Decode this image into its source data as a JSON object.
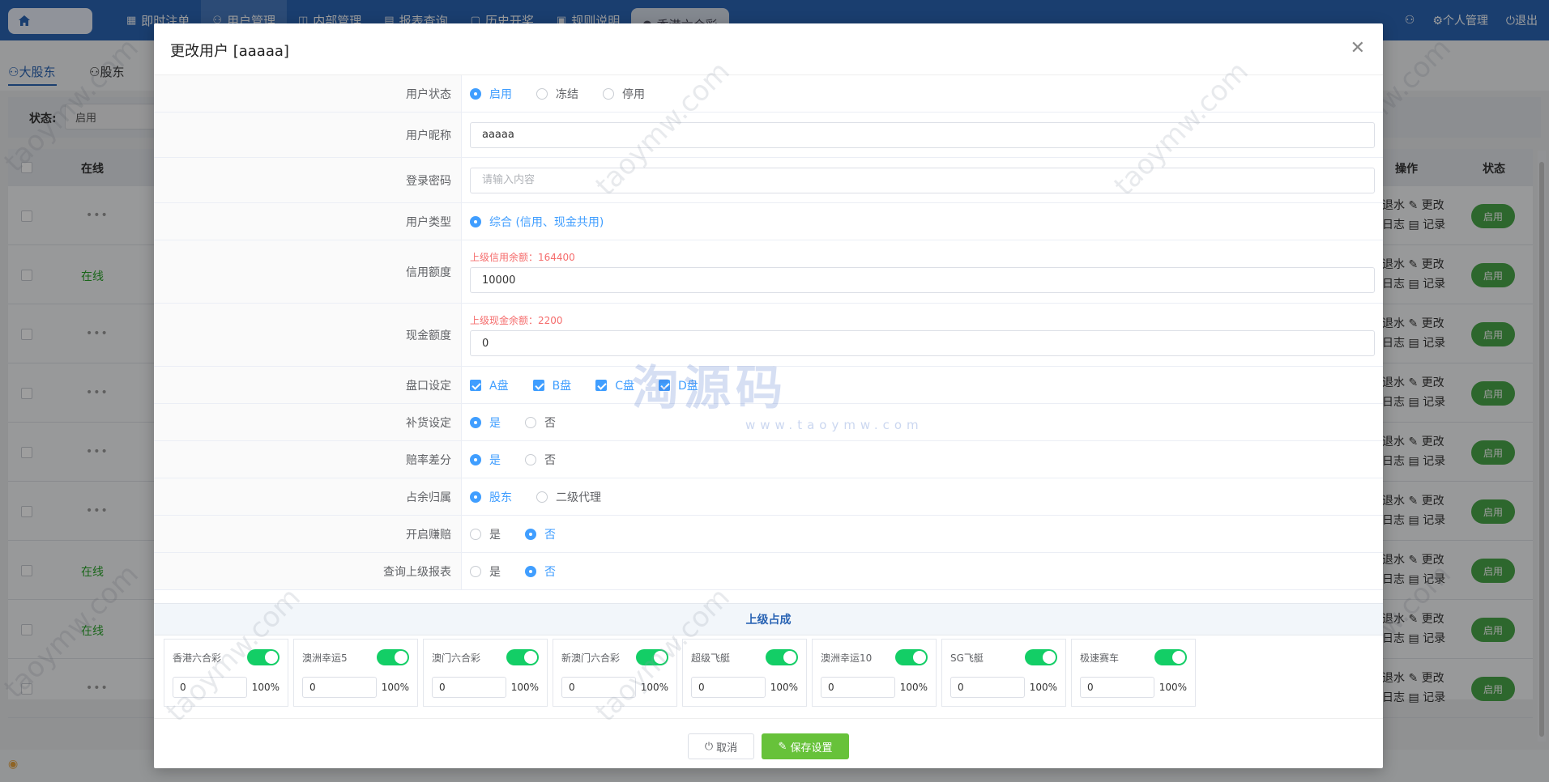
{
  "nav": {
    "items": [
      {
        "label": "即时注单",
        "icon": "▦"
      },
      {
        "label": "用户管理",
        "icon": "⚇"
      },
      {
        "label": "内部管理",
        "icon": "◫"
      },
      {
        "label": "报表查询",
        "icon": "▤"
      },
      {
        "label": "历史开奖",
        "icon": "▢"
      },
      {
        "label": "规则说明",
        "icon": "▣"
      }
    ],
    "lottery_tab": "香港六合彩",
    "personal": "个人管理",
    "logout": "退出"
  },
  "background": {
    "subtabs": [
      "大股东",
      "股东"
    ],
    "filter_label": "状态:",
    "filter_value": "启用",
    "col_online": "在线",
    "col_ops": "操作",
    "col_status": "状态",
    "online_text": "在线",
    "dots_text": "•••",
    "ops_line1": "退水 ✎ 更改",
    "ops_line2": "日志 ▤ 记录",
    "status_btn": "启用"
  },
  "modal": {
    "title": "更改用户 [aaaaa]",
    "fields": {
      "status": {
        "label": "用户状态",
        "options": [
          "启用",
          "冻结",
          "停用"
        ],
        "selected": 0
      },
      "nickname": {
        "label": "用户昵称",
        "value": "aaaaa"
      },
      "password": {
        "label": "登录密码",
        "placeholder": "请输入内容"
      },
      "user_type": {
        "label": "用户类型",
        "option": "综合 (信用、现金共用)"
      },
      "credit": {
        "label": "信用额度",
        "hint": "上级信用余额：164400",
        "value": "10000"
      },
      "cash": {
        "label": "现金额度",
        "hint": "上级现金余额：2200",
        "value": "0"
      },
      "pankou": {
        "label": "盘口设定",
        "options": [
          "A盘",
          "B盘",
          "C盘",
          "D盘"
        ]
      },
      "buhuo": {
        "label": "补货设定",
        "options": [
          "是",
          "否"
        ],
        "selected": 0
      },
      "peilv": {
        "label": "赔率差分",
        "options": [
          "是",
          "否"
        ],
        "selected": 0
      },
      "zhanyu": {
        "label": "占余归属",
        "options": [
          "股东",
          "二级代理"
        ],
        "selected": 0
      },
      "zhuanpei": {
        "label": "开启赚赔",
        "options": [
          "是",
          "否"
        ],
        "selected": 1
      },
      "report": {
        "label": "查询上级报表",
        "options": [
          "是",
          "否"
        ],
        "selected": 1
      }
    },
    "section_title": "上级占成",
    "games": [
      {
        "name": "香港六合彩",
        "value": "0",
        "pct": "100%"
      },
      {
        "name": "澳洲幸运5",
        "value": "0",
        "pct": "100%"
      },
      {
        "name": "澳门六合彩",
        "value": "0",
        "pct": "100%"
      },
      {
        "name": "新澳门六合彩",
        "value": "0",
        "pct": "100%"
      },
      {
        "name": "超级飞艇",
        "value": "0",
        "pct": "100%"
      },
      {
        "name": "澳洲幸运10",
        "value": "0",
        "pct": "100%"
      },
      {
        "name": "SG飞艇",
        "value": "0",
        "pct": "100%"
      },
      {
        "name": "极速赛车",
        "value": "0",
        "pct": "100%"
      }
    ],
    "cancel_label": "取消",
    "save_label": "保存设置"
  },
  "watermark": {
    "text": "taoymw.com",
    "logo_cn": "淘源码",
    "logo_en": "www.taoymw.com"
  },
  "colors": {
    "primary": "#2a64b4",
    "accent": "#409eff",
    "success": "#67c23a",
    "switch_on": "#13ce66",
    "danger": "#f56c6c"
  }
}
